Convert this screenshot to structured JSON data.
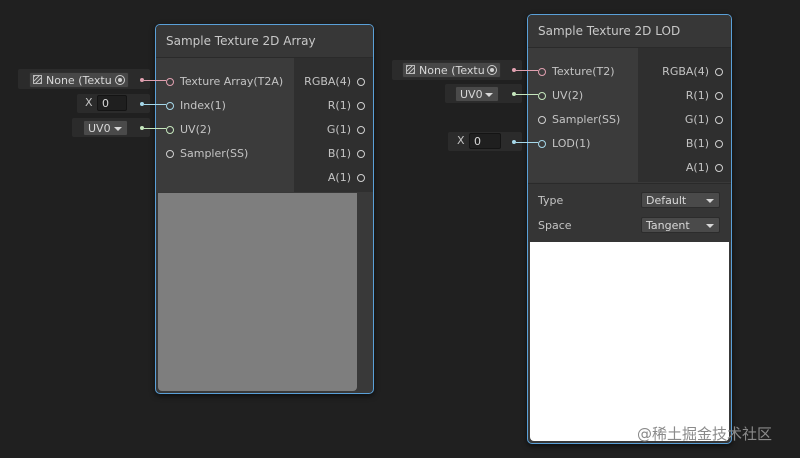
{
  "node_array": {
    "title": "Sample Texture 2D Array",
    "inputs": [
      "Texture Array(T2A)",
      "Index(1)",
      "UV(2)",
      "Sampler(SS)"
    ],
    "outputs": [
      "RGBA(4)",
      "R(1)",
      "G(1)",
      "B(1)",
      "A(1)"
    ]
  },
  "node_lod": {
    "title": "Sample Texture 2D LOD",
    "inputs": [
      "Texture(T2)",
      "UV(2)",
      "Sampler(SS)",
      "LOD(1)"
    ],
    "outputs": [
      "RGBA(4)",
      "R(1)",
      "G(1)",
      "B(1)",
      "A(1)"
    ],
    "settings": {
      "type_label": "Type",
      "type_value": "Default",
      "space_label": "Space",
      "space_value": "Tangent"
    }
  },
  "widgets": {
    "array_texture": "None (Textu",
    "array_index_label": "X",
    "array_index_value": "0",
    "array_uv": "UV0",
    "lod_texture": "None (Textu",
    "lod_uv": "UV0",
    "lod_lod_label": "X",
    "lod_lod_value": "0"
  },
  "watermark": "@稀土掘金技术社区",
  "colors": {
    "node_border": "#5aa0d8",
    "background": "#202020",
    "texture_port": "#e0a0b0",
    "vector_port": "#c5e6bd",
    "float_port": "#a6d8ea"
  }
}
